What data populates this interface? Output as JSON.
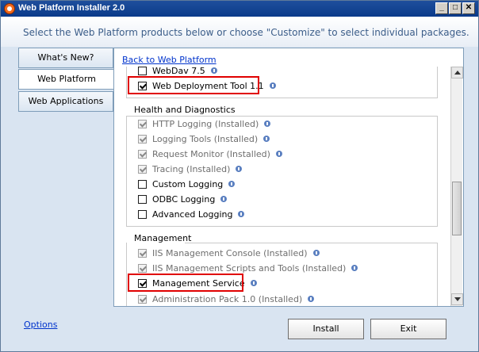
{
  "window": {
    "title": "Web Platform Installer 2.0"
  },
  "header": {
    "text": "Select the Web Platform products below or choose \"Customize\" to select individual packages."
  },
  "tabs": [
    {
      "label": "What's New?"
    },
    {
      "label": "Web Platform"
    },
    {
      "label": "Web Applications"
    }
  ],
  "content": {
    "back_link": "Back to Web Platform",
    "top_items": [
      {
        "label": "WebDav 7.5",
        "checked": false
      },
      {
        "label": "Web Deployment Tool 1.1",
        "checked": true
      }
    ],
    "health": {
      "title": "Health and Diagnostics",
      "items": [
        {
          "label": "HTTP Logging  (Installed)"
        },
        {
          "label": "Logging Tools  (Installed)"
        },
        {
          "label": "Request Monitor  (Installed)"
        },
        {
          "label": "Tracing  (Installed)"
        },
        {
          "label": "Custom Logging"
        },
        {
          "label": "ODBC Logging"
        },
        {
          "label": "Advanced Logging"
        }
      ]
    },
    "management": {
      "title": "Management",
      "items": [
        {
          "label": "IIS Management Console  (Installed)"
        },
        {
          "label": "IIS Management Scripts and Tools  (Installed)"
        },
        {
          "label": "Management Service"
        },
        {
          "label": "Administration Pack 1.0  (Installed)"
        }
      ]
    }
  },
  "footer": {
    "options_label": "Options",
    "install_label": "Install",
    "exit_label": "Exit"
  },
  "colors": {
    "highlight": "#e00000",
    "link": "#0033cc"
  }
}
